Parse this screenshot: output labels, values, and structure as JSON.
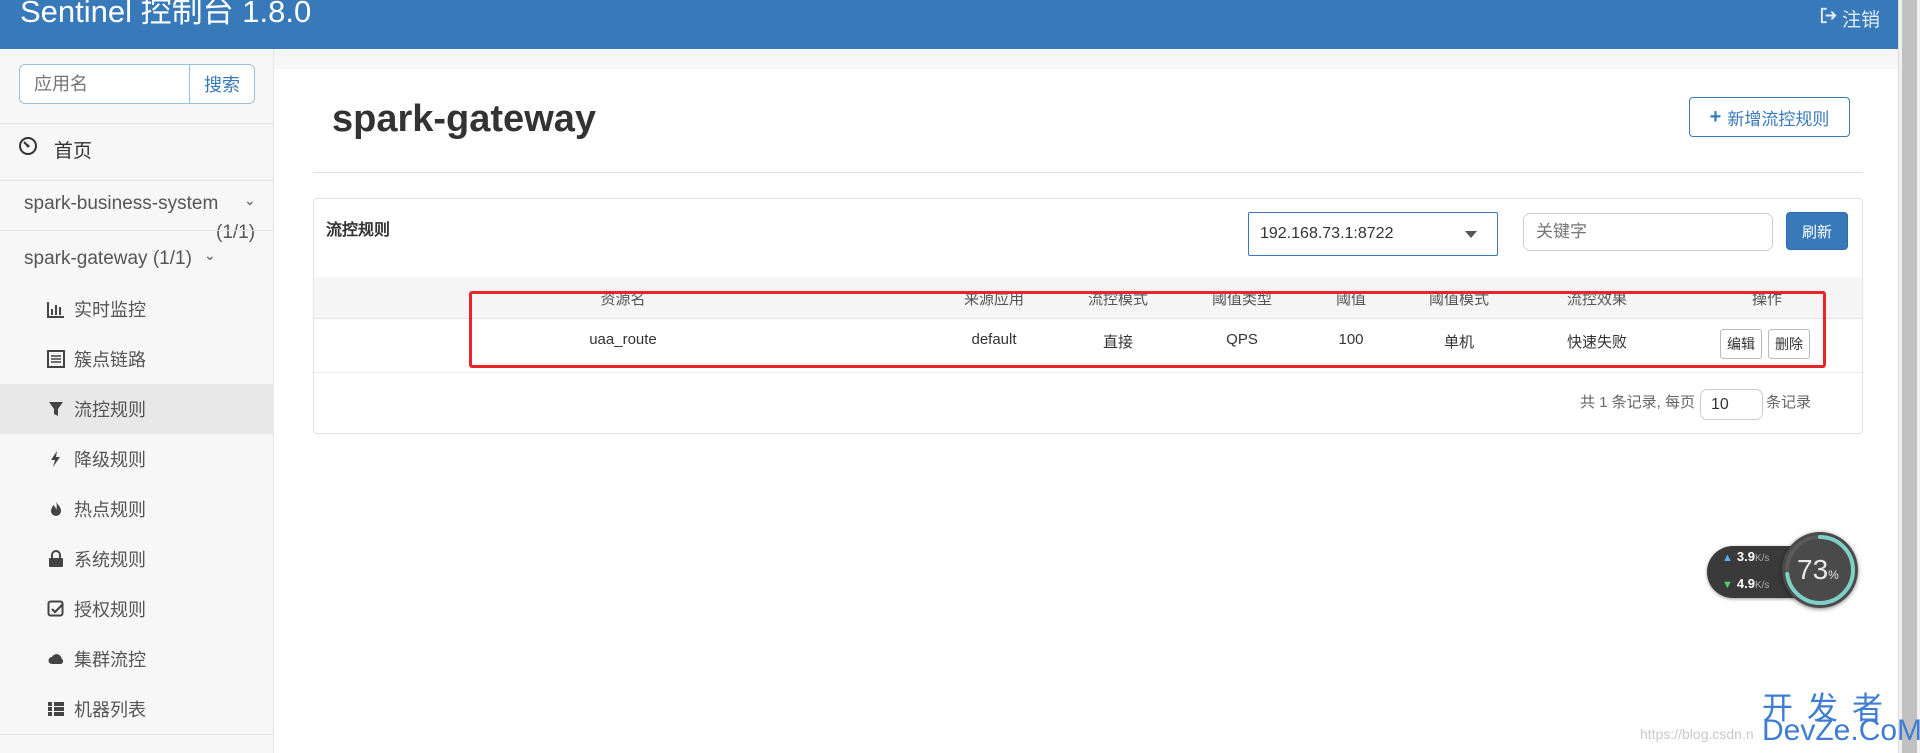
{
  "header": {
    "brand": "Sentinel 控制台 1.8.0",
    "logout_label": "注销"
  },
  "sidebar": {
    "search_placeholder": "应用名",
    "search_button": "搜索",
    "home_label": "首页",
    "apps": [
      {
        "name": "spark-business-system",
        "count": "(1/1)"
      },
      {
        "name": "spark-gateway",
        "count": "(1/1)"
      }
    ],
    "menu": [
      {
        "label": "实时监控",
        "icon": "bar-chart-icon"
      },
      {
        "label": "簇点链路",
        "icon": "list-alt-icon"
      },
      {
        "label": "流控规则",
        "icon": "filter-icon",
        "active": true
      },
      {
        "label": "降级规则",
        "icon": "flash-icon"
      },
      {
        "label": "热点规则",
        "icon": "fire-icon"
      },
      {
        "label": "系统规则",
        "icon": "lock-icon"
      },
      {
        "label": "授权规则",
        "icon": "check-icon"
      },
      {
        "label": "集群流控",
        "icon": "cloud-icon"
      },
      {
        "label": "机器列表",
        "icon": "th-list-icon"
      }
    ]
  },
  "main": {
    "title": "spark-gateway",
    "add_button": "新增流控规则",
    "panel_title": "流控规则",
    "machine_selected": "192.168.73.1:8722",
    "keyword_placeholder": "关键字",
    "refresh_button": "刷新",
    "table": {
      "headers": [
        "资源名",
        "来源应用",
        "流控模式",
        "阈值类型",
        "阈值",
        "阈值模式",
        "流控效果",
        "操作"
      ],
      "rows": [
        {
          "resource": "uaa_route",
          "origin": "default",
          "mode": "直接",
          "grade": "QPS",
          "count": "100",
          "cluster_mode": "单机",
          "effect": "快速失败",
          "edit": "编辑",
          "delete": "删除"
        }
      ]
    },
    "pager": {
      "prefix": "共 1 条记录, 每页",
      "page_size": "10",
      "suffix": "条记录"
    }
  },
  "network_monitor": {
    "upload": "3.9",
    "download": "4.9",
    "unit": "K/s",
    "percent": "73",
    "percent_sign": "%"
  },
  "watermark": {
    "cn": "开发者",
    "en": "DevZe.CoM",
    "url": "https://blog.csdn.n"
  },
  "colors": {
    "primary": "#3779b9",
    "highlight": "#e8262a",
    "watermark": "#3e7dd1"
  }
}
